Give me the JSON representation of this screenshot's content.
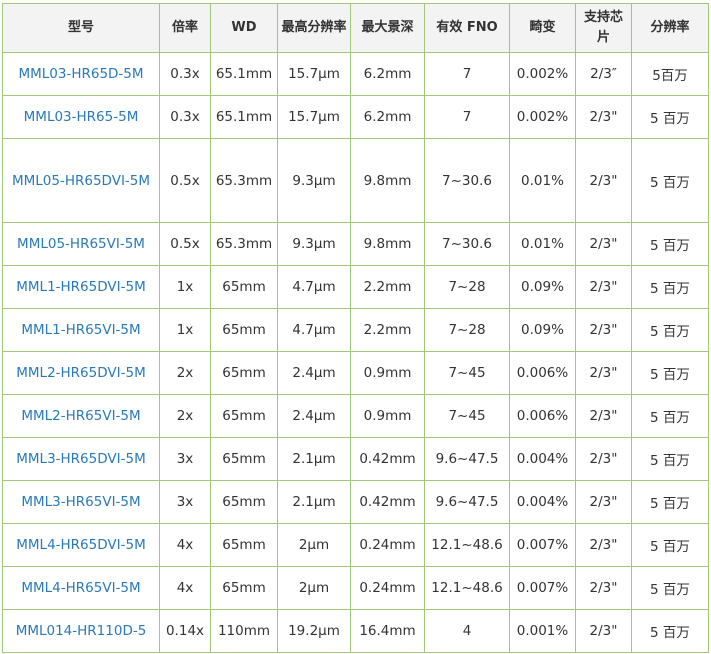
{
  "table": {
    "headers": [
      {
        "key": "model",
        "label": "型号"
      },
      {
        "key": "magnification",
        "label": "倍率"
      },
      {
        "key": "wd",
        "label": "WD"
      },
      {
        "key": "max_resolution",
        "label": "最高分辨率"
      },
      {
        "key": "max_dof",
        "label": "最大景深"
      },
      {
        "key": "effective_fno",
        "label": "有效 FNO"
      },
      {
        "key": "distortion",
        "label": "畸变"
      },
      {
        "key": "supported_chip",
        "label": "支持芯片"
      },
      {
        "key": "resolution",
        "label": "分辨率"
      }
    ],
    "rows": [
      {
        "model": "MML03-HR65D-5M",
        "magnification": "0.3x",
        "wd": "65.1mm",
        "max_resolution": "15.7μm",
        "max_dof": "6.2mm",
        "effective_fno": "7",
        "distortion": "0.002%",
        "supported_chip": "2/3″",
        "resolution": "5百万"
      },
      {
        "model": "MML03-HR65-5M",
        "magnification": "0.3x",
        "wd": "65.1mm",
        "max_resolution": "15.7μm",
        "max_dof": "6.2mm",
        "effective_fno": "7",
        "distortion": "0.002%",
        "supported_chip": "2/3\"",
        "resolution": "5 百万"
      },
      {
        "model": "MML05-HR65DVI-5M",
        "magnification": "0.5x",
        "wd": "65.3mm",
        "max_resolution": "9.3μm",
        "max_dof": "9.8mm",
        "effective_fno": "7~30.6",
        "distortion": "0.01%",
        "supported_chip": "2/3\"",
        "resolution": "5 百万"
      },
      {
        "model": "MML05-HR65VI-5M",
        "magnification": "0.5x",
        "wd": "65.3mm",
        "max_resolution": "9.3μm",
        "max_dof": "9.8mm",
        "effective_fno": "7~30.6",
        "distortion": "0.01%",
        "supported_chip": "2/3\"",
        "resolution": "5 百万"
      },
      {
        "model": "MML1-HR65DVI-5M",
        "magnification": "1x",
        "wd": "65mm",
        "max_resolution": "4.7μm",
        "max_dof": "2.2mm",
        "effective_fno": "7~28",
        "distortion": "0.09%",
        "supported_chip": "2/3\"",
        "resolution": "5 百万"
      },
      {
        "model": "MML1-HR65VI-5M",
        "magnification": "1x",
        "wd": "65mm",
        "max_resolution": "4.7μm",
        "max_dof": "2.2mm",
        "effective_fno": "7~28",
        "distortion": "0.09%",
        "supported_chip": "2/3\"",
        "resolution": "5 百万"
      },
      {
        "model": "MML2-HR65DVI-5M",
        "magnification": "2x",
        "wd": "65mm",
        "max_resolution": "2.4μm",
        "max_dof": "0.9mm",
        "effective_fno": "7~45",
        "distortion": "0.006%",
        "supported_chip": "2/3\"",
        "resolution": "5 百万"
      },
      {
        "model": "MML2-HR65VI-5M",
        "magnification": "2x",
        "wd": "65mm",
        "max_resolution": "2.4μm",
        "max_dof": "0.9mm",
        "effective_fno": "7~45",
        "distortion": "0.006%",
        "supported_chip": "2/3\"",
        "resolution": "5 百万"
      },
      {
        "model": "MML3-HR65DVI-5M",
        "magnification": "3x",
        "wd": "65mm",
        "max_resolution": "2.1μm",
        "max_dof": "0.42mm",
        "effective_fno": "9.6~47.5",
        "distortion": "0.004%",
        "supported_chip": "2/3\"",
        "resolution": "5 百万"
      },
      {
        "model": "MML3-HR65VI-5M",
        "magnification": "3x",
        "wd": "65mm",
        "max_resolution": "2.1μm",
        "max_dof": "0.42mm",
        "effective_fno": "9.6~47.5",
        "distortion": "0.004%",
        "supported_chip": "2/3\"",
        "resolution": "5 百万"
      },
      {
        "model": "MML4-HR65DVI-5M",
        "magnification": "4x",
        "wd": "65mm",
        "max_resolution": "2μm",
        "max_dof": "0.24mm",
        "effective_fno": "12.1~48.6",
        "distortion": "0.007%",
        "supported_chip": "2/3\"",
        "resolution": "5 百万"
      },
      {
        "model": "MML4-HR65VI-5M",
        "magnification": "4x",
        "wd": "65mm",
        "max_resolution": "2μm",
        "max_dof": "0.24mm",
        "effective_fno": "12.1~48.6",
        "distortion": "0.007%",
        "supported_chip": "2/3\"",
        "resolution": "5 百万"
      },
      {
        "model": "MML014-HR110D-5",
        "magnification": "0.14x",
        "wd": "110mm",
        "max_resolution": "19.2μm",
        "max_dof": "16.4mm",
        "effective_fno": "4",
        "distortion": "0.001%",
        "supported_chip": "2/3\"",
        "resolution": "5 百万"
      }
    ]
  },
  "colors": {
    "border": "#a3c77a",
    "header_bg": "#f3f3f3",
    "model_link": "#2a7ab8",
    "text": "#333333"
  }
}
